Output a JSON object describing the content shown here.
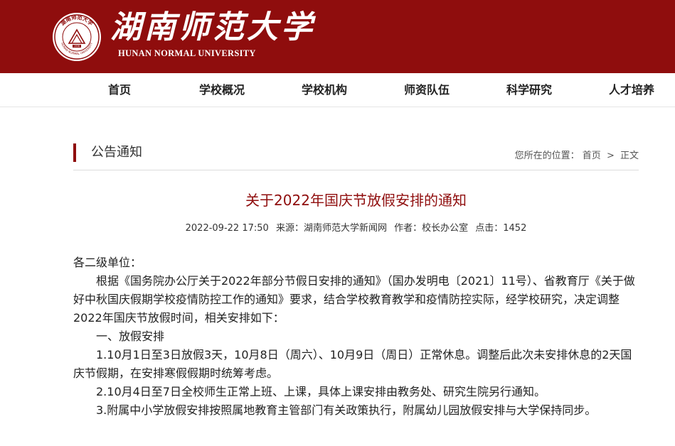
{
  "header": {
    "title": "湖南师范大学",
    "subtitle": "HUNAN NORMAL UNIVERSITY",
    "seal": {
      "text_top": "湖南师范大学",
      "text_bottom": "HUNAN NORMAL UNIVERSITY",
      "year": "1938"
    }
  },
  "nav": {
    "items": [
      {
        "label": "首页"
      },
      {
        "label": "学校概况"
      },
      {
        "label": "学校机构"
      },
      {
        "label": "师资队伍"
      },
      {
        "label": "科学研究"
      },
      {
        "label": "人才培养"
      }
    ]
  },
  "section": {
    "title": "公告通知",
    "breadcrumb_prefix": "您所在的位置：",
    "breadcrumb_home": "首页",
    "breadcrumb_sep": ">",
    "breadcrumb_current": "正文"
  },
  "article": {
    "title": "关于2022年国庆节放假安排的通知",
    "meta": {
      "datetime": "2022-09-22 17:50",
      "source": "来源：湖南师范大学新闻网",
      "author": "作者：校长办公室",
      "hits": "点击：1452"
    },
    "paragraphs": [
      "各二级单位：",
      "根据《国务院办公厅关于2022年部分节假日安排的通知》（国办发明电〔2021〕11号）、省教育厅《关于做好中秋国庆假期学校疫情防控工作的通知》要求，结合学校教育教学和疫情防控实际，经学校研究，决定调整2022年国庆节放假时间，相关安排如下：",
      "一、放假安排",
      "1.10月1日至3日放假3天，10月8日（周六）、10月9日（周日）正常休息。调整后此次未安排休息的2天国庆节假期，在安排寒假假期时统筹考虑。",
      "2.10月4日至7日全校师生正常上班、上课，具体上课安排由教务处、研究生院另行通知。",
      "3.附属中小学放假安排按照属地教育主管部门有关政策执行，附属幼儿园放假安排与大学保持同步。"
    ]
  },
  "colors": {
    "brand": "#8f0d0d"
  }
}
